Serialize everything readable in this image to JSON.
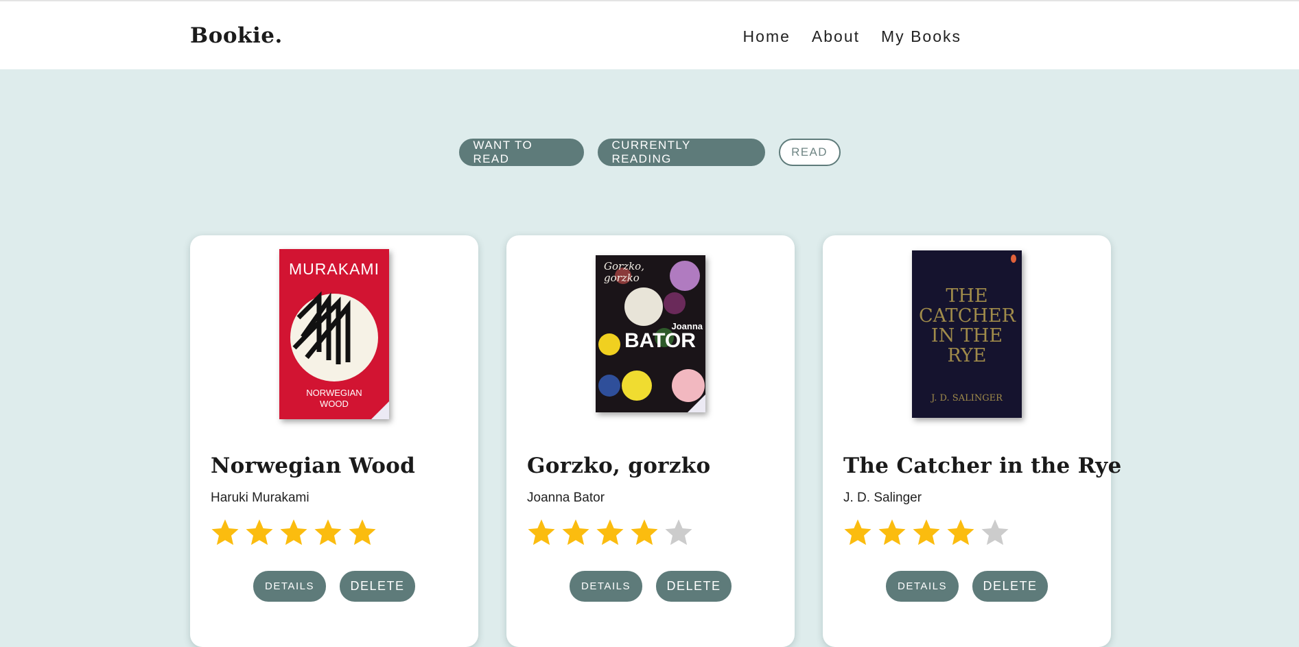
{
  "header": {
    "brand": "Bookie.",
    "nav": [
      "Home",
      "About",
      "My Books"
    ]
  },
  "filters": [
    "WANT TO READ",
    "CURRENTLY READING",
    "READ"
  ],
  "books": [
    {
      "title": "Norwegian Wood",
      "author": "Haruki Murakami",
      "rating": 5,
      "cover": {
        "top": "MURAKAMI",
        "bottom": "NORWEGIAN WOOD"
      },
      "details_label": "DETAILS",
      "delete_label": "DELETE"
    },
    {
      "title": "Gorzko, gorzko",
      "author": "Joanna Bator",
      "rating": 4,
      "cover": {
        "top": "Gorzko, gorzko",
        "small": "Joanna",
        "bottom": "BATOR"
      },
      "details_label": "DETAILS",
      "delete_label": "DELETE"
    },
    {
      "title": "The Catcher in the Rye",
      "author": "J. D. Salinger",
      "rating": 4,
      "cover": {
        "top": "THE CATCHER IN THE RYE",
        "bottom": "J. D. SALINGER"
      },
      "details_label": "DETAILS",
      "delete_label": "DELETE"
    }
  ],
  "colors": {
    "background": "#deecec",
    "accent": "#5e7b7a",
    "star_on": "#fbbc0f",
    "star_off": "#cccccc"
  }
}
